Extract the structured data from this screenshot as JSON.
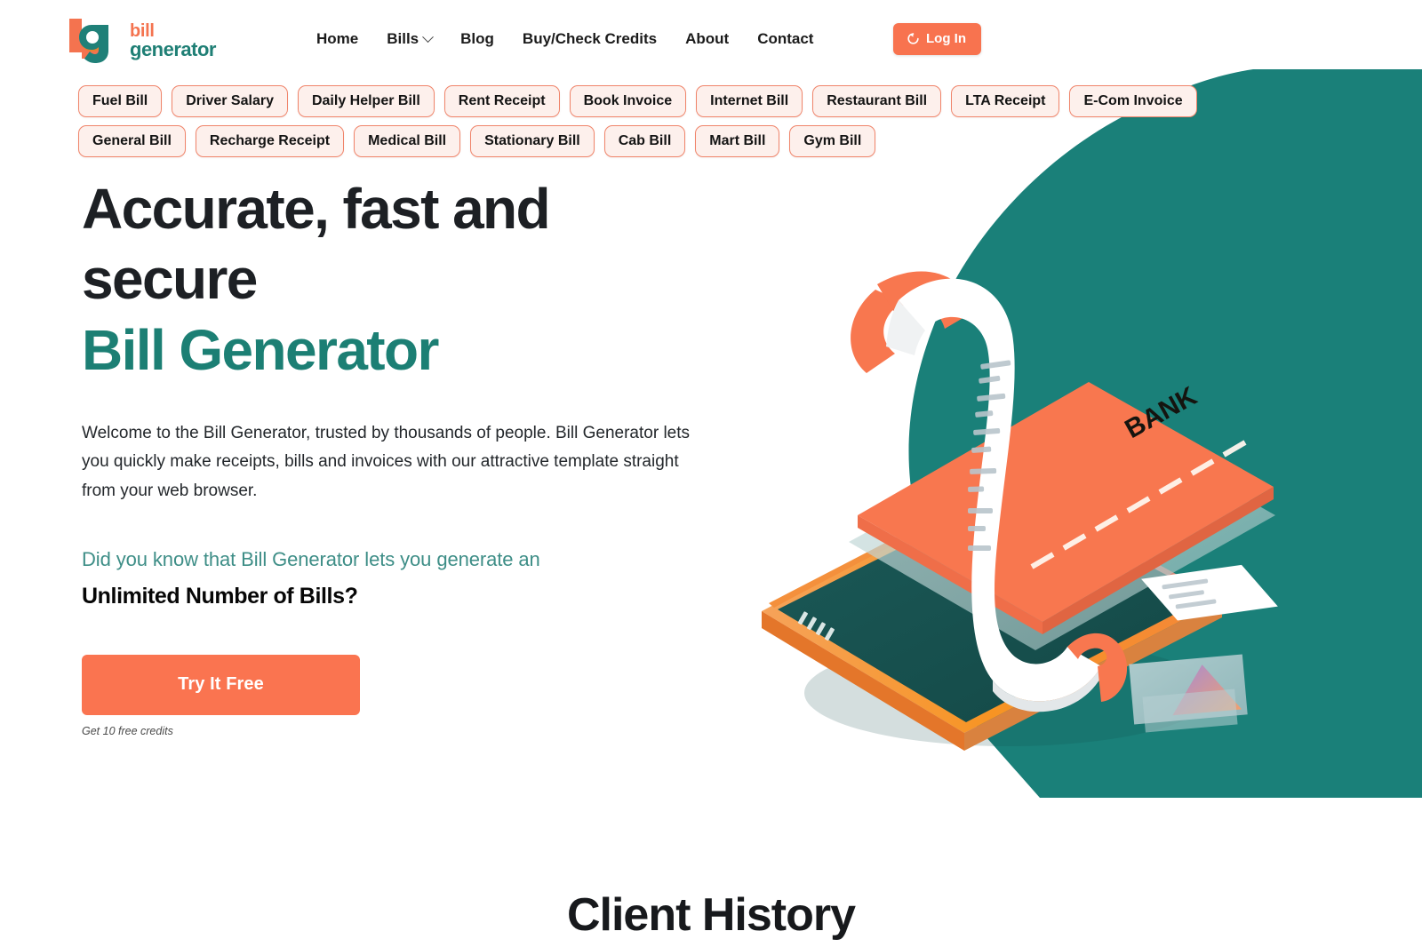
{
  "brand": {
    "logo_line1": "bill",
    "logo_line2": "generator",
    "logo_mark": "bg-monogram-icon",
    "orange": "#f8734f",
    "teal": "#1c7f74"
  },
  "nav": {
    "items": [
      {
        "label": "Home",
        "has_dropdown": false
      },
      {
        "label": "Bills",
        "has_dropdown": true
      },
      {
        "label": "Blog",
        "has_dropdown": false
      },
      {
        "label": "Buy/Check Credits",
        "has_dropdown": false
      },
      {
        "label": "About",
        "has_dropdown": false
      },
      {
        "label": "Contact",
        "has_dropdown": false
      }
    ],
    "login_label": "Log In",
    "login_icon": "login-arrow-icon"
  },
  "tags": [
    "Fuel Bill",
    "Driver Salary",
    "Daily Helper Bill",
    "Rent Receipt",
    "Book Invoice",
    "Internet Bill",
    "Restaurant Bill",
    "LTA Receipt",
    "E-Com Invoice",
    "General Bill",
    "Recharge Receipt",
    "Medical Bill",
    "Stationary Bill",
    "Cab Bill",
    "Mart Bill",
    "Gym Bill"
  ],
  "hero": {
    "title_line1": "Accurate, fast and",
    "title_line2": "secure",
    "title_accent": "Bill Generator",
    "paragraph": "Welcome to the Bill Generator, trusted by thousands of people. Bill Generator lets you quickly make receipts, bills and invoices with our attractive template straight from your web browser.",
    "know_line": "Did you know that Bill Generator lets you generate an",
    "unlimited_line": "Unlimited Number of Bills?",
    "cta_label": "Try It Free",
    "cta_note": "Get 10 free credits"
  },
  "illustration": {
    "card_label": "BANK",
    "name": "isometric-phone-bank-card-receipt-illustration"
  },
  "sections": {
    "client_history_title": "Client History"
  }
}
